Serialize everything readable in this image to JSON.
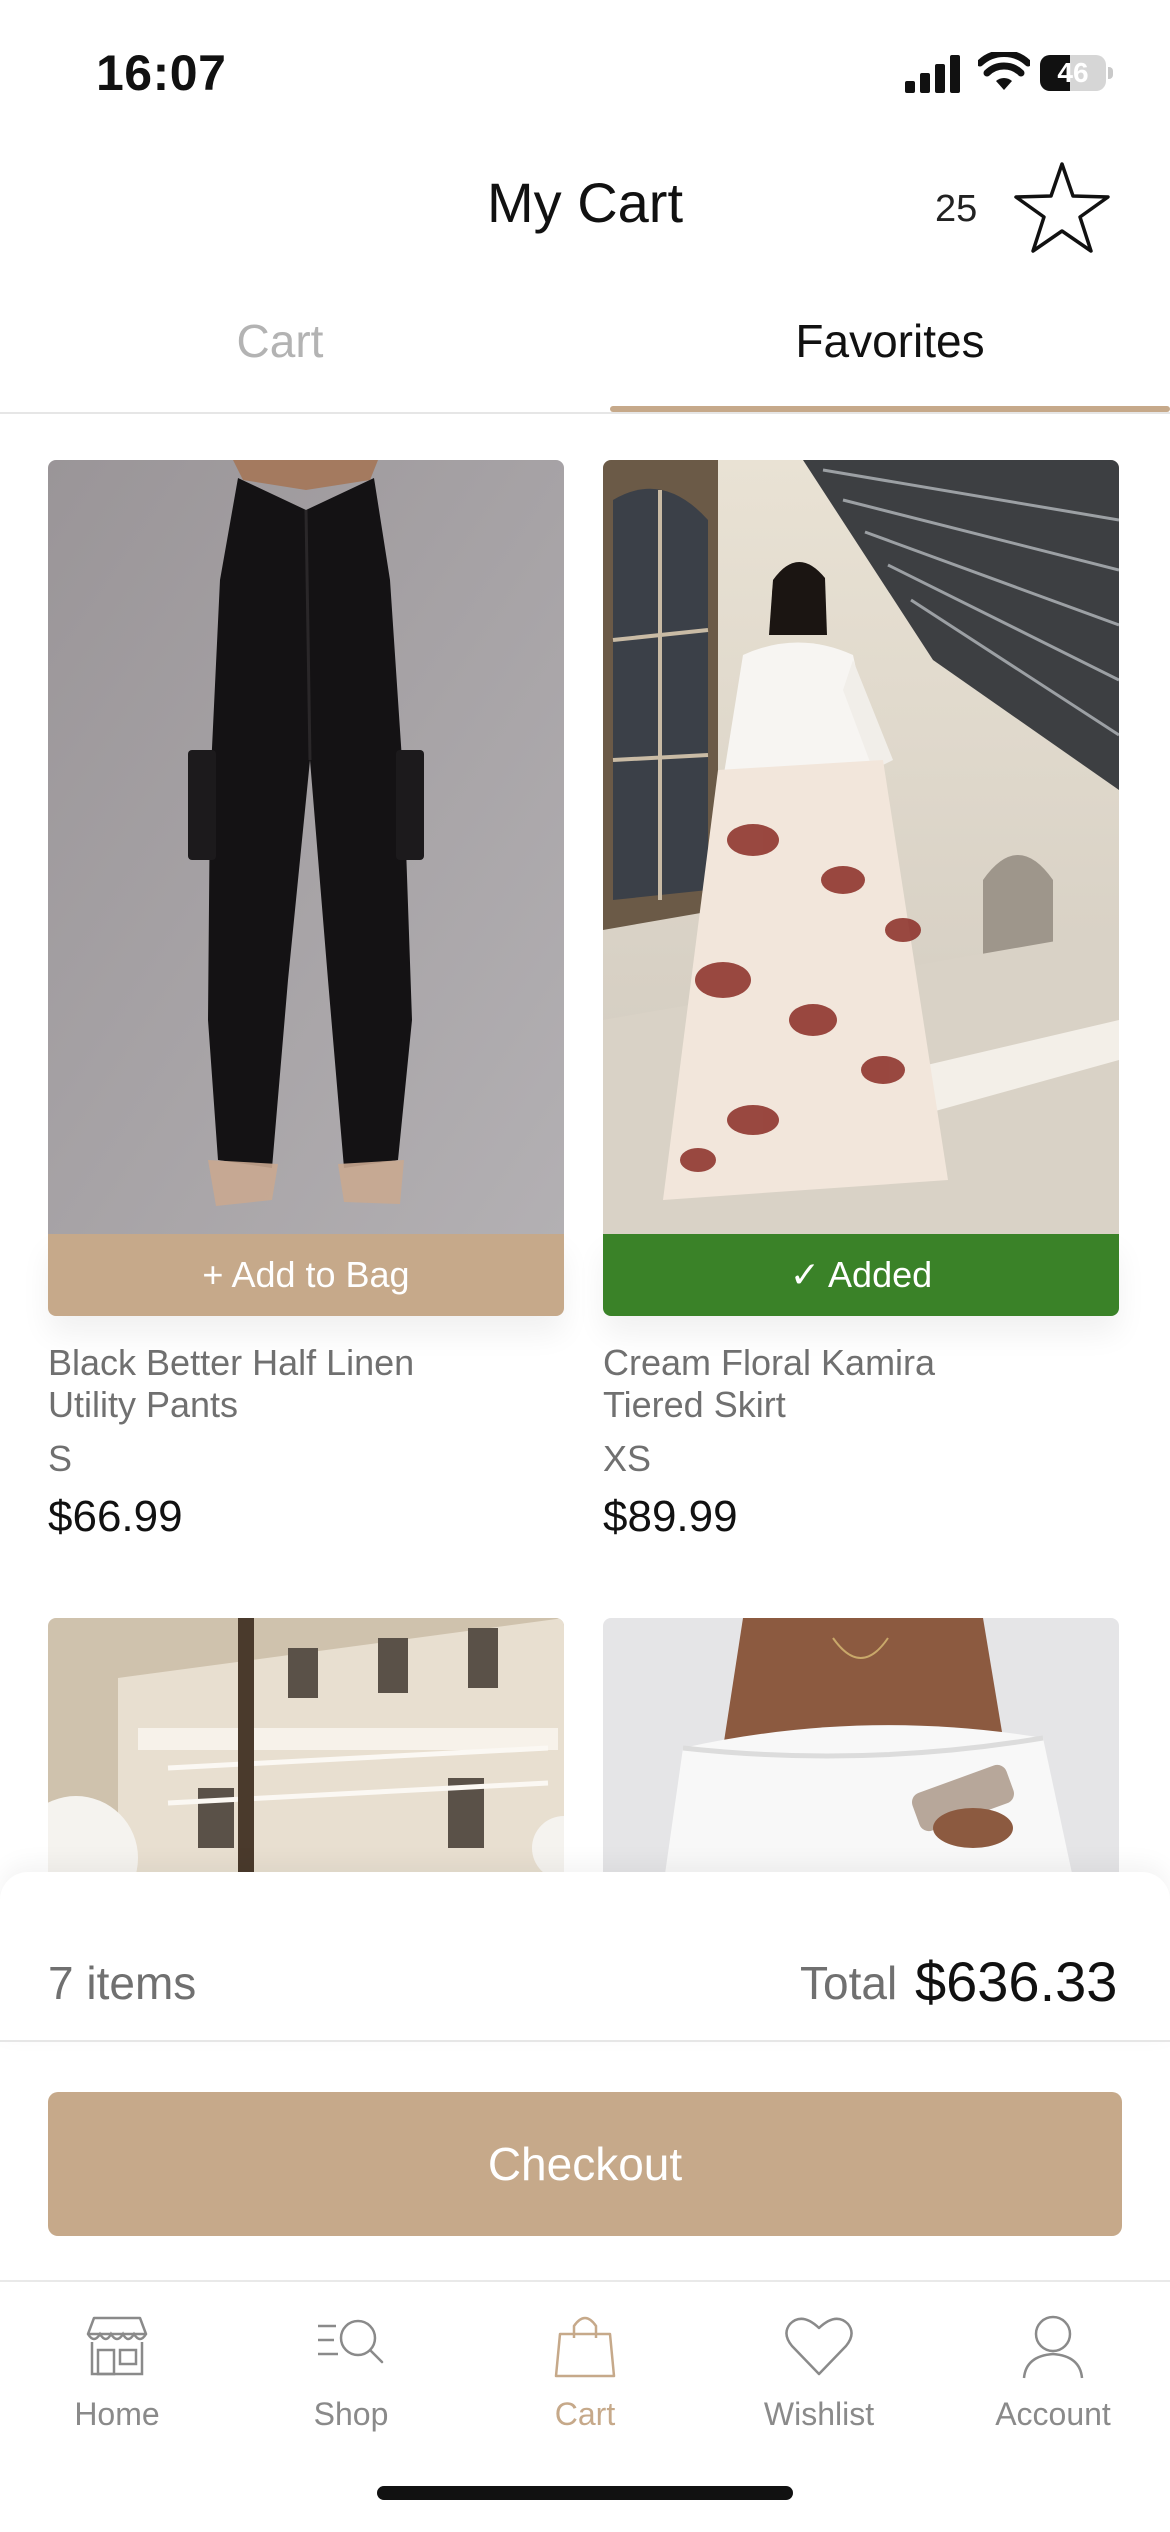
{
  "status_bar": {
    "time": "16:07",
    "battery_percent": "46",
    "battery_level": 0.46,
    "icons": [
      "cellular-signal-icon",
      "wifi-icon",
      "battery-icon"
    ]
  },
  "header": {
    "title": "My Cart",
    "favorites_count": "25",
    "star_icon": "star-outline-icon"
  },
  "tabs": [
    {
      "label": "Cart",
      "active": false
    },
    {
      "label": "Favorites",
      "active": true
    }
  ],
  "products": [
    {
      "name_line1": "Black Better Half Linen",
      "name_line2": "Utility Pants",
      "size": "S",
      "price": "$66.99",
      "button": "+ Add to Bag",
      "added": false
    },
    {
      "name_line1": "Cream Floral Kamira",
      "name_line2": "Tiered Skirt",
      "size": "XS",
      "price": "$89.99",
      "button": "✓ Added",
      "added": true
    },
    {
      "name_line1": "",
      "name_line2": "",
      "size": "",
      "price": "",
      "button": "",
      "added": false
    },
    {
      "name_line1": "",
      "name_line2": "",
      "size": "",
      "price": "",
      "button": "",
      "added": false
    }
  ],
  "summary": {
    "items": "7 items",
    "total_label": "Total",
    "total_value": "$636.33"
  },
  "checkout_label": "Checkout",
  "nav": [
    {
      "label": "Home",
      "icon": "storefront-icon",
      "active": false
    },
    {
      "label": "Shop",
      "icon": "search-list-icon",
      "active": false
    },
    {
      "label": "Cart",
      "icon": "shopping-bag-icon",
      "active": true
    },
    {
      "label": "Wishlist",
      "icon": "heart-icon",
      "active": false
    },
    {
      "label": "Account",
      "icon": "person-icon",
      "active": false
    }
  ],
  "colors": {
    "accent": "#c6a98a",
    "added_green": "#3a8228",
    "muted_text": "#707070"
  }
}
